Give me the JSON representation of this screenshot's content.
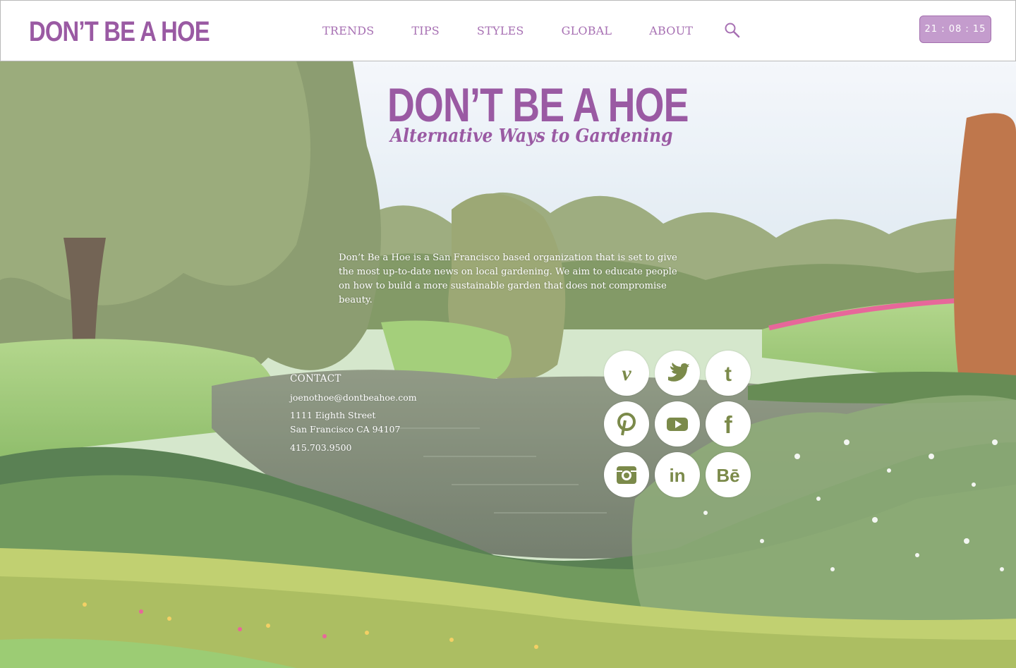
{
  "header": {
    "logo": "DON’T BE A HOE",
    "nav": [
      "TRENDS",
      "TIPS",
      "STYLES",
      "GLOBAL",
      "ABOUT"
    ],
    "clock": "21 : 08 : 15",
    "search_icon": "search-icon"
  },
  "hero": {
    "title": "DON’T BE A HOE",
    "subtitle": "Alternative Ways to Gardening",
    "about": "Don’t Be a Hoe is a San Francisco based organization that is set to give the most up-to-date news on local gardening. We aim to educate people on how to build a more sustainable garden that does not compromise beauty."
  },
  "contact": {
    "heading": "CONTACT",
    "email": "joenothoe@dontbeahoe.com",
    "street": "1111 Eighth Street",
    "city": "San Francisco CA 94107",
    "phone": "415.703.9500"
  },
  "social": [
    {
      "name": "vimeo-icon",
      "label": "v"
    },
    {
      "name": "twitter-icon",
      "label": ""
    },
    {
      "name": "tumblr-icon",
      "label": "t"
    },
    {
      "name": "pinterest-icon",
      "label": "p"
    },
    {
      "name": "youtube-icon",
      "label": ""
    },
    {
      "name": "facebook-icon",
      "label": "f"
    },
    {
      "name": "instagram-icon",
      "label": ""
    },
    {
      "name": "linkedin-icon",
      "label": "in"
    },
    {
      "name": "behance-icon",
      "label": "Bē"
    }
  ],
  "colors": {
    "brand": "#9a5aa3",
    "nav": "#a770b3",
    "clock_bg": "#c49ccd",
    "icon_fill": "#7b8a4a"
  }
}
